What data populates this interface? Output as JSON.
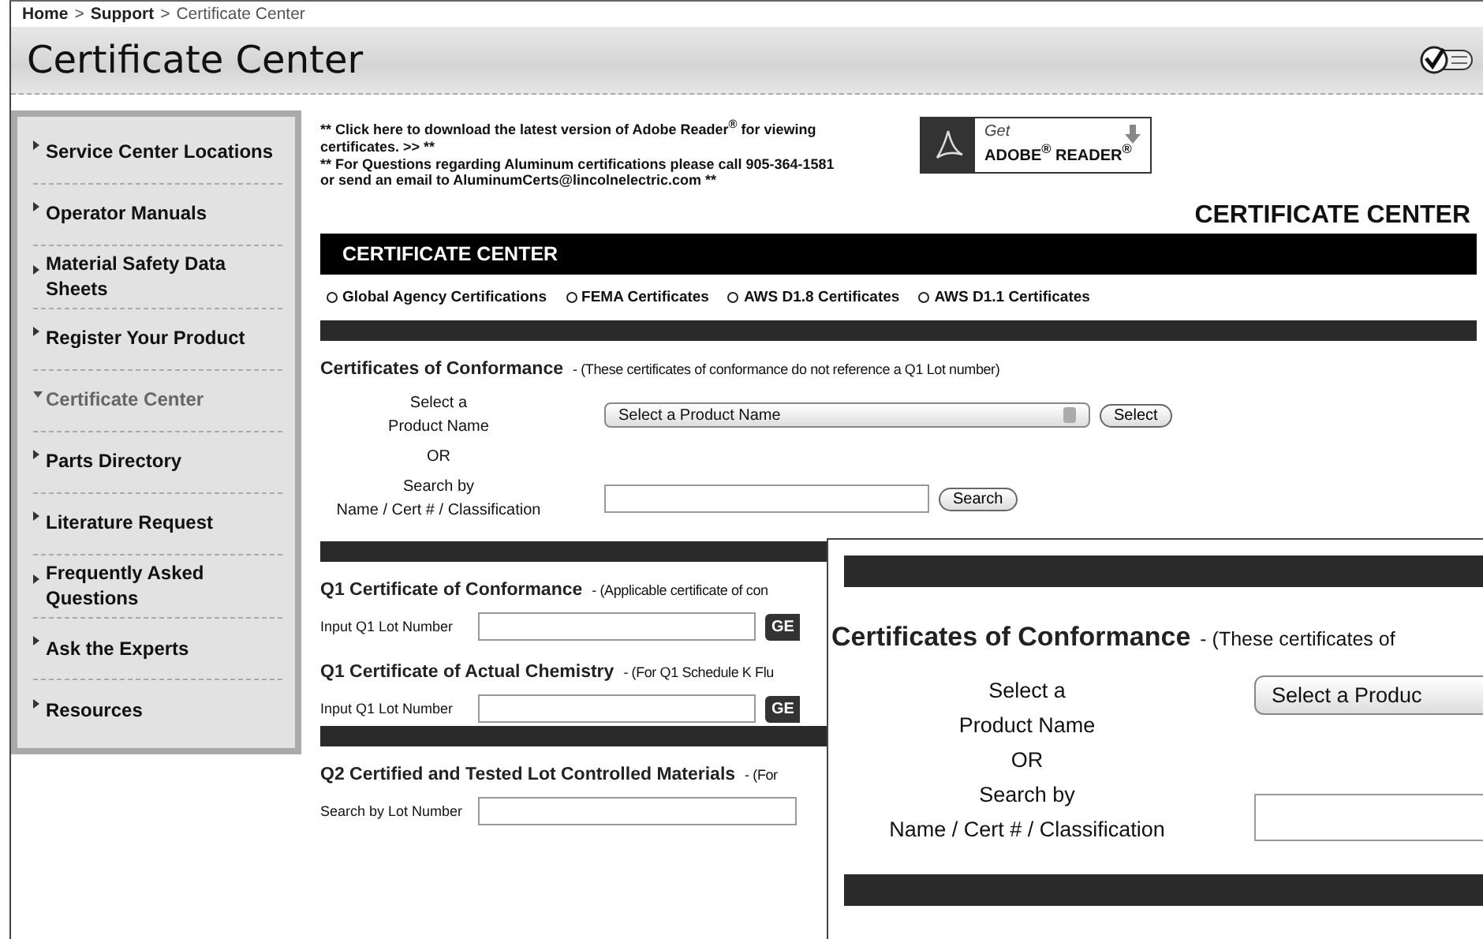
{
  "breadcrumb": {
    "separator": ">",
    "items": [
      {
        "label": "Home",
        "current": false
      },
      {
        "label": "Support",
        "current": false
      },
      {
        "label": "Certificate Center",
        "current": true
      }
    ]
  },
  "page_title": "Certificate Center",
  "sidebar": {
    "items": [
      {
        "label": "Service Center Locations",
        "selected": false
      },
      {
        "label": "Operator Manuals",
        "selected": false
      },
      {
        "label": "Material Safety Data Sheets",
        "selected": false
      },
      {
        "label": "Register Your Product",
        "selected": false
      },
      {
        "label": "Certificate Center",
        "selected": true
      },
      {
        "label": "Parts Directory",
        "selected": false
      },
      {
        "label": "Literature Request",
        "selected": false
      },
      {
        "label": "Frequently Asked Questions",
        "selected": false
      },
      {
        "label": "Ask the Experts",
        "selected": false
      },
      {
        "label": "Resources",
        "selected": false
      }
    ]
  },
  "notices": [
    "** Click here to download the latest version of Adobe Reader$^{®}$ for viewing certificates. >> **",
    "** For Questions regarding Aluminum certifications please call 905-364-1581 or send an email to AluminumCerts@lincolnelectric.com **"
  ],
  "adobe_badge": {
    "line_1": "Get",
    "line_2": "ADOBE$^{®}$ READER$^{®}$"
  },
  "heading": "CERTIFICATE CENTER",
  "banner": "CERTIFICATE CENTER",
  "links": [
    "Global Agency Certifications",
    "FEMA Certificates",
    "AWS D1.8 Certificates",
    "AWS D1.1 Certificates"
  ],
  "conformance": {
    "title": "Certificates of Conformance",
    "note": "- (These certificates of conformance do not reference a Q1 Lot number)",
    "select_label_1": "Select a",
    "select_label_2": "Product Name",
    "select_value": "Select a Product Name",
    "select_button": "Select",
    "or": "OR",
    "search_label_1": "Search by",
    "search_label_2": "Name / Cert # / Classification",
    "search_button": "Search"
  },
  "q1_sections": [
    {
      "title": "Q1 Certificate of Conformance",
      "note": "- (Applicable certificate of con",
      "field_label": "Input Q1 Lot Number",
      "button": "GE"
    },
    {
      "title": "Q1 Certificate of Actual Chemistry",
      "note": "- (For Q1 Schedule K Flu",
      "field_label": "Input Q1 Lot Number",
      "button": "GE"
    }
  ],
  "q2_section": {
    "title": "Q2 Certified and Tested Lot Controlled Materials",
    "note": "- (For",
    "field_label": "Search by Lot Number"
  },
  "inset": {
    "title": "Certificates of Conformance",
    "note": "- (These certificates of",
    "select_label_1": "Select a",
    "select_label_2": "Product Name",
    "or": "OR",
    "search_label_1": "Search by",
    "search_label_2": "Name / Cert # / Classification",
    "select_value": "Select a Produc"
  }
}
